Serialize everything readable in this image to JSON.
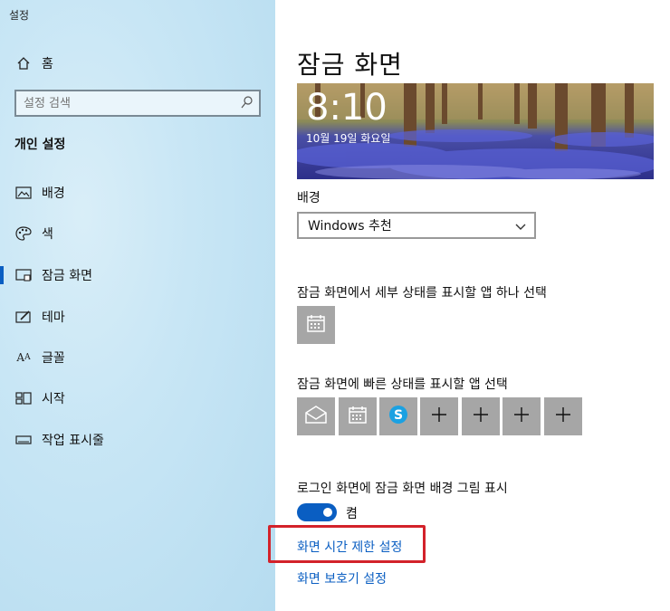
{
  "window": {
    "title": "설정"
  },
  "sidebar": {
    "home_label": "홈",
    "search_placeholder": "설정 검색",
    "section_heading": "개인 설정",
    "items": [
      {
        "label": "배경",
        "icon": "picture-icon"
      },
      {
        "label": "색",
        "icon": "palette-icon"
      },
      {
        "label": "잠금 화면",
        "icon": "lock-screen-icon",
        "active": true
      },
      {
        "label": "테마",
        "icon": "theme-icon"
      },
      {
        "label": "글꼴",
        "icon": "font-icon"
      },
      {
        "label": "시작",
        "icon": "start-icon"
      },
      {
        "label": "작업 표시줄",
        "icon": "taskbar-icon"
      }
    ]
  },
  "main": {
    "title": "잠금 화면",
    "preview": {
      "time": "8:10",
      "date": "10월 19일 화요일"
    },
    "background_label": "배경",
    "background_value": "Windows 추천",
    "detailed_status_label": "잠금 화면에서 세부 상태를 표시할 앱 하나 선택",
    "quick_status_label": "잠금 화면에 빠른 상태를 표시할 앱 선택",
    "quick_tiles": [
      "mail-icon",
      "calendar-icon",
      "skype-icon",
      "plus-icon",
      "plus-icon",
      "plus-icon",
      "plus-icon"
    ],
    "signin_bg_label": "로그인 화면에 잠금 화면 배경 그림 표시",
    "toggle_state": "켬",
    "link_timeout": "화면 시간 제한 설정",
    "link_screensaver": "화면 보호기 설정"
  },
  "colors": {
    "accent": "#0a5ec2",
    "highlight_box": "#d3222a",
    "tile_bg": "#a6a6a6"
  }
}
